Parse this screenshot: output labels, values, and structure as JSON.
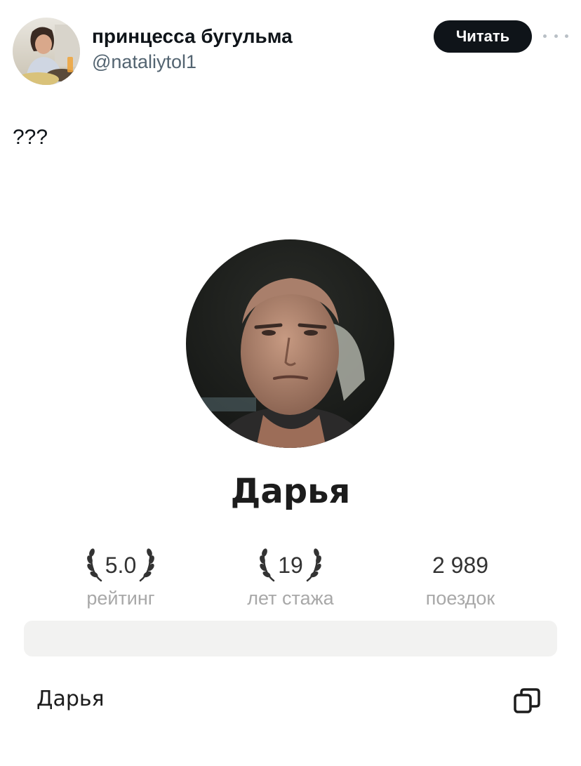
{
  "tweet": {
    "author_name": "принцесса бугульма",
    "author_handle": "@nataliytol1",
    "follow_label": "Читать",
    "text": "???"
  },
  "driver_card": {
    "name": "Дарья",
    "stats": [
      {
        "value": "5.0",
        "label": "рейтинг",
        "laurel": true
      },
      {
        "value": "19",
        "label": "лет стажа",
        "laurel": true
      },
      {
        "value": "2 989",
        "label": "поездок",
        "laurel": false
      }
    ],
    "bottom_name": "Дарья",
    "copy_icon": "copy-icon"
  },
  "colors": {
    "follow_button_bg": "#0f1419",
    "handle_gray": "#536471",
    "stat_label_gray": "#a8a8a8",
    "bar_bg": "#f2f2f1"
  }
}
